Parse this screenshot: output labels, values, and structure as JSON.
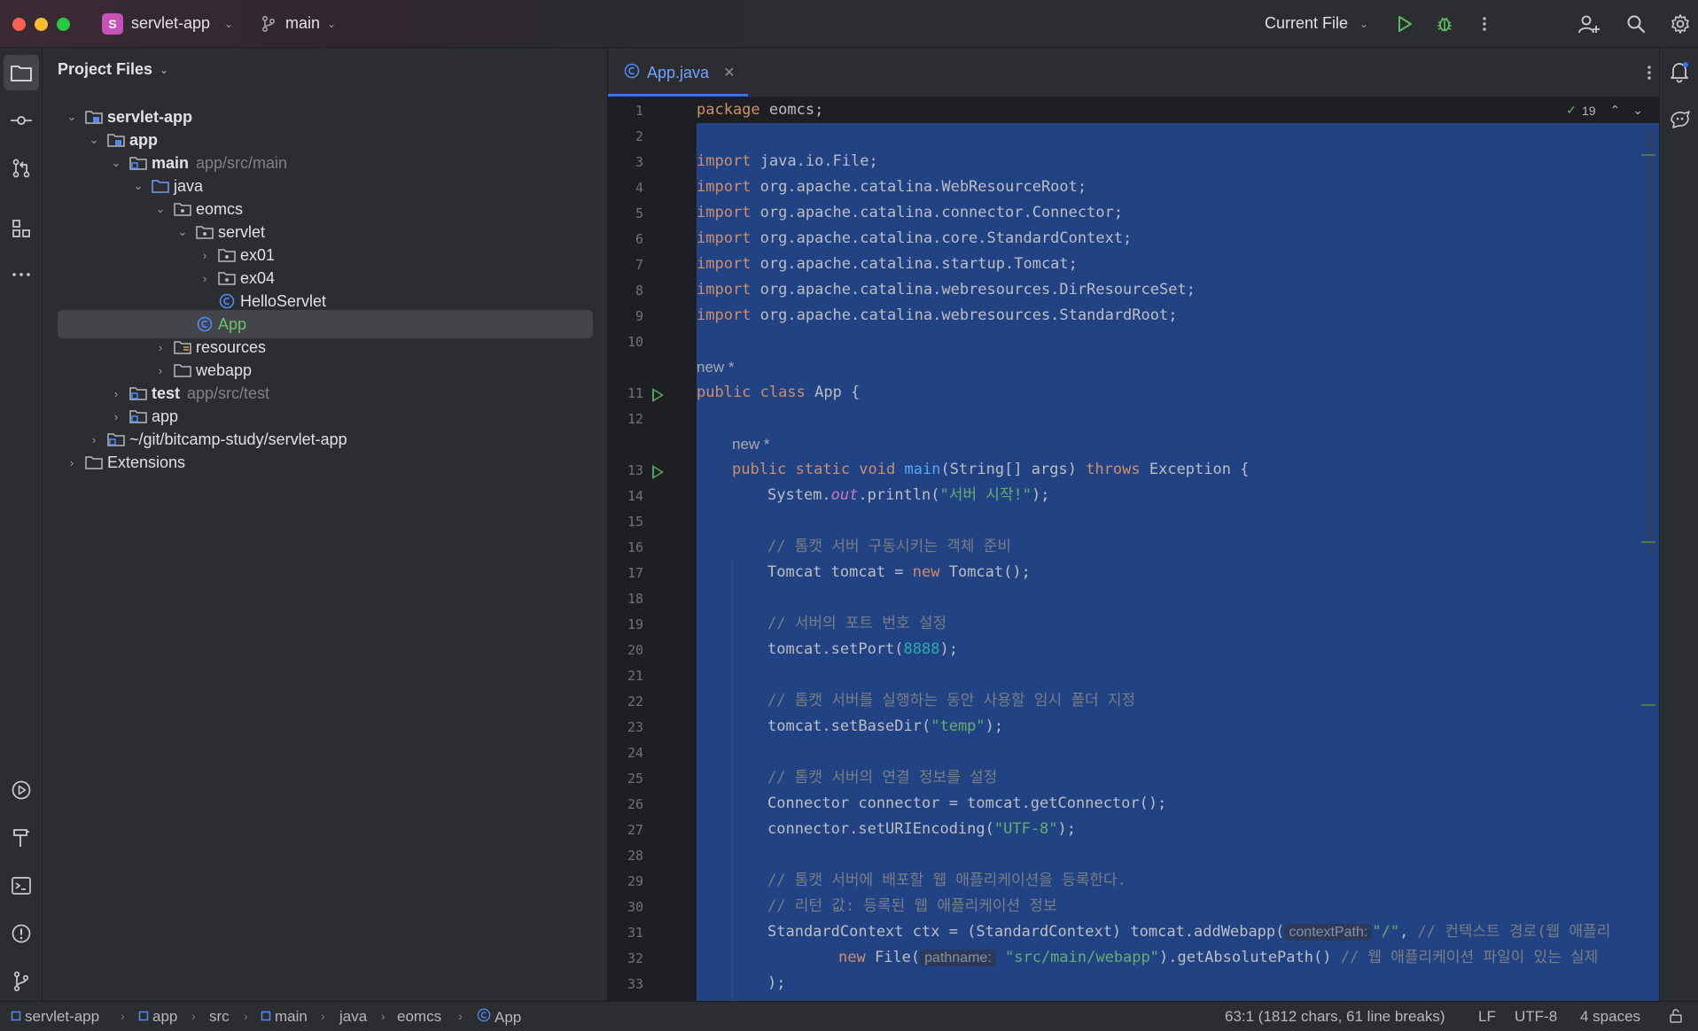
{
  "titlebar": {
    "project_initial": "S",
    "project_name": "servlet-app",
    "branch": "main",
    "run_config": "Current File"
  },
  "project_panel": {
    "title": "Project Files",
    "tree": [
      {
        "label": "servlet-app",
        "hint": "",
        "bold": true
      },
      {
        "label": "app",
        "hint": "",
        "bold": true
      },
      {
        "label": "main",
        "hint": "app/src/main",
        "bold": true
      },
      {
        "label": "java",
        "hint": "",
        "bold": false
      },
      {
        "label": "eomcs",
        "hint": "",
        "bold": false
      },
      {
        "label": "servlet",
        "hint": "",
        "bold": false
      },
      {
        "label": "ex01",
        "hint": "",
        "bold": false
      },
      {
        "label": "ex04",
        "hint": "",
        "bold": false
      },
      {
        "label": "HelloServlet",
        "hint": "",
        "bold": false
      },
      {
        "label": "App",
        "hint": "",
        "bold": false
      },
      {
        "label": "resources",
        "hint": "",
        "bold": false
      },
      {
        "label": "webapp",
        "hint": "",
        "bold": false
      },
      {
        "label": "test",
        "hint": "app/src/test",
        "bold": true
      },
      {
        "label": "app",
        "hint": "",
        "bold": false
      },
      {
        "label": "~/git/bitcamp-study/servlet-app",
        "hint": "",
        "bold": false
      },
      {
        "label": "Extensions",
        "hint": "",
        "bold": false
      }
    ]
  },
  "editor": {
    "tab_label": "App.java",
    "inspection_count": "19",
    "line_numbers": [
      "1",
      "2",
      "3",
      "4",
      "5",
      "6",
      "7",
      "8",
      "9",
      "10",
      "11",
      "12",
      "13",
      "14",
      "15",
      "16",
      "17",
      "18",
      "19",
      "20",
      "21",
      "22",
      "23",
      "24",
      "25",
      "26",
      "27",
      "28",
      "29",
      "30",
      "31",
      "32",
      "33"
    ],
    "code": {
      "l1_kw": "package",
      "l1_rest": " eomcs;",
      "l3_kw": "import",
      "l3_rest": " java.io.File;",
      "l4_kw": "import",
      "l4_rest": " org.apache.catalina.WebResourceRoot;",
      "l5_kw": "import",
      "l5_rest": " org.apache.catalina.connector.Connector;",
      "l6_kw": "import",
      "l6_rest": " org.apache.catalina.core.StandardContext;",
      "l7_kw": "import",
      "l7_rest": " org.apache.catalina.startup.Tomcat;",
      "l8_kw": "import",
      "l8_rest": " org.apache.catalina.webresources.DirResourceSet;",
      "l9_kw": "import",
      "l9_rest": " org.apache.catalina.webresources.StandardRoot;",
      "author1": "new *",
      "l11_kw1": "public",
      "l11_kw2": "class",
      "l11_rest": " App {",
      "author2": "new *",
      "l13_kw": "public static void",
      "l13_fn": "main",
      "l13_a": "(String[] args) ",
      "l13_kw2": "throws",
      "l13_b": " Exception {",
      "l14_a": "System.",
      "l14_out": "out",
      "l14_b": ".println(",
      "l14_str": "\"서버 시작!\"",
      "l14_c": ");",
      "l16_cmt": "// 톰캣 서버 구동시키는 객체 준비",
      "l17_a": "Tomcat tomcat = ",
      "l17_kw": "new",
      "l17_b": " Tomcat();",
      "l19_cmt": "// 서버의 포트 번호 설정",
      "l20_a": "tomcat.setPort(",
      "l20_num": "8888",
      "l20_b": ");",
      "l22_cmt": "// 톰캣 서버를 실행하는 동안 사용할 임시 폴더 지정",
      "l23_a": "tomcat.setBaseDir(",
      "l23_str": "\"temp\"",
      "l23_b": ");",
      "l25_cmt": "// 톰캣 서버의 연결 정보를 설정",
      "l26_a": "Connector connector = tomcat.getConnector();",
      "l27_a": "connector.setURIEncoding(",
      "l27_str": "\"UTF-8\"",
      "l27_b": ");",
      "l29_cmt": "// 톰캣 서버에 배포할 웹 애플리케이션을 등록한다.",
      "l30_cmt": "// 리턴 값: 등록된 웹 애플리케이션 정보",
      "l31_a": "StandardContext ctx = (StandardContext) tomcat.addWebapp(",
      "l31_hint": "contextPath:",
      "l31_str": "\"/\"",
      "l31_b": ", ",
      "l31_cmt": "// 컨텍스트 경로(웹 애플리",
      "l32_kw": "new",
      "l32_a": " File(",
      "l32_hint": "pathname:",
      "l32_str": "\"src/main/webapp\"",
      "l32_b": ").getAbsolutePath() ",
      "l32_cmt": "// 웹 애플리케이션 파일이 있는 실제",
      "l33_a": ");"
    }
  },
  "statusbar": {
    "crumbs": [
      "servlet-app",
      "app",
      "src",
      "main",
      "java",
      "eomcs",
      "App"
    ],
    "position": "63:1 (1812 chars, 61 line breaks)",
    "line_sep": "LF",
    "encoding": "UTF-8",
    "indent": "4 spaces"
  },
  "colors": {
    "selection": "#214283",
    "keyword": "#cf8e6d",
    "string": "#6aab73",
    "comment": "#7a7e85",
    "accent": "#3574f0"
  }
}
